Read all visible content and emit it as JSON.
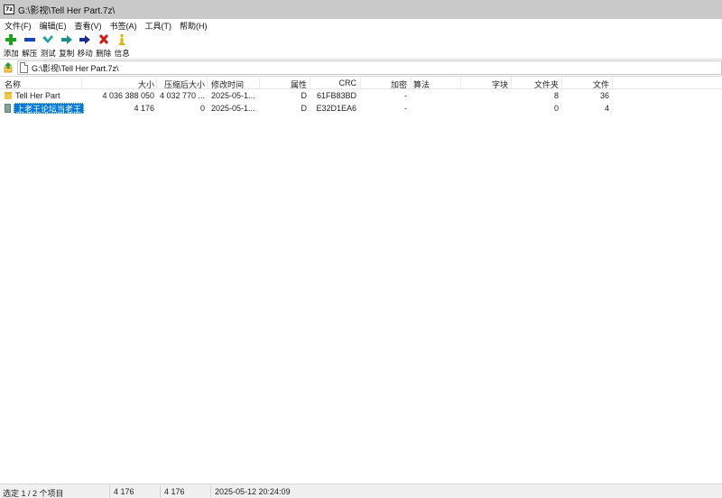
{
  "window": {
    "title": "G:\\影视\\Tell Her Part.7z\\"
  },
  "app_icon_text": "7z",
  "menu": [
    "文件(F)",
    "编辑(E)",
    "查看(V)",
    "书签(A)",
    "工具(T)",
    "帮助(H)"
  ],
  "toolbar": [
    {
      "label": "添加",
      "icon": "plus-icon",
      "color": "#1fa01f"
    },
    {
      "label": "解压",
      "icon": "minus-icon",
      "color": "#1b44b8"
    },
    {
      "label": "测试",
      "icon": "check-icon",
      "color": "#2aa3a3"
    },
    {
      "label": "复制",
      "icon": "copy-arrow-icon",
      "color": "#1d8f86"
    },
    {
      "label": "移动",
      "icon": "move-arrow-icon",
      "color": "#1c2f8f"
    },
    {
      "label": "删除",
      "icon": "delete-x-icon",
      "color": "#d41919"
    },
    {
      "label": "信息",
      "icon": "info-icon",
      "color": "#d8b400"
    }
  ],
  "address": {
    "path": "G:\\影视\\Tell Her Part.7z\\"
  },
  "columns": {
    "name": "名称",
    "size": "大小",
    "packed": "压缩后大小",
    "modified": "修改时间",
    "attributes": "属性",
    "crc": "CRC",
    "encrypted": "加密",
    "method": "算法",
    "block": "字块",
    "folders": "文件夹",
    "files": "文件"
  },
  "rows": [
    {
      "type": "folder",
      "name": "Tell Her Part",
      "size": "4 036 388 050",
      "packed": "4 032 770 ...",
      "modified": "2025-05-1...",
      "attributes": "D",
      "crc": "61FB83BD",
      "encrypted": "-",
      "method": "",
      "block": "",
      "folders": "8",
      "files": "36",
      "selected": false
    },
    {
      "type": "file",
      "name": "上老王论坛当老王",
      "size": "4 176",
      "packed": "0",
      "modified": "2025-05-1...",
      "attributes": "D",
      "crc": "E32D1EA6",
      "encrypted": "-",
      "method": "",
      "block": "",
      "folders": "0",
      "files": "4",
      "selected": true
    }
  ],
  "status": {
    "selection": "选定 1 / 2 个项目",
    "size": "4 176",
    "packed": "4 176",
    "modified": "2025-05-12 20:24:09"
  }
}
